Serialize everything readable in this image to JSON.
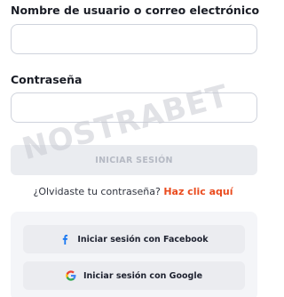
{
  "form": {
    "username_label": "Nombre de usuario o correo electrónico",
    "username_value": "",
    "password_label": "Contraseña",
    "password_value": "",
    "login_button": "INICIAR SESIÓN",
    "forgot_text": "¿Olvidaste tu contraseña?",
    "forgot_link": "Haz clic aquí"
  },
  "social": {
    "facebook_label": "Iniciar sesión con Facebook",
    "facebook_icon": "facebook-icon",
    "google_label": "Iniciar sesión con Google",
    "google_icon": "google-icon"
  },
  "watermark": {
    "text": "NOSTRABET"
  },
  "colors": {
    "link": "#ea4b1e",
    "facebook": "#1877f2",
    "disabled_button": "#eaecf0"
  }
}
